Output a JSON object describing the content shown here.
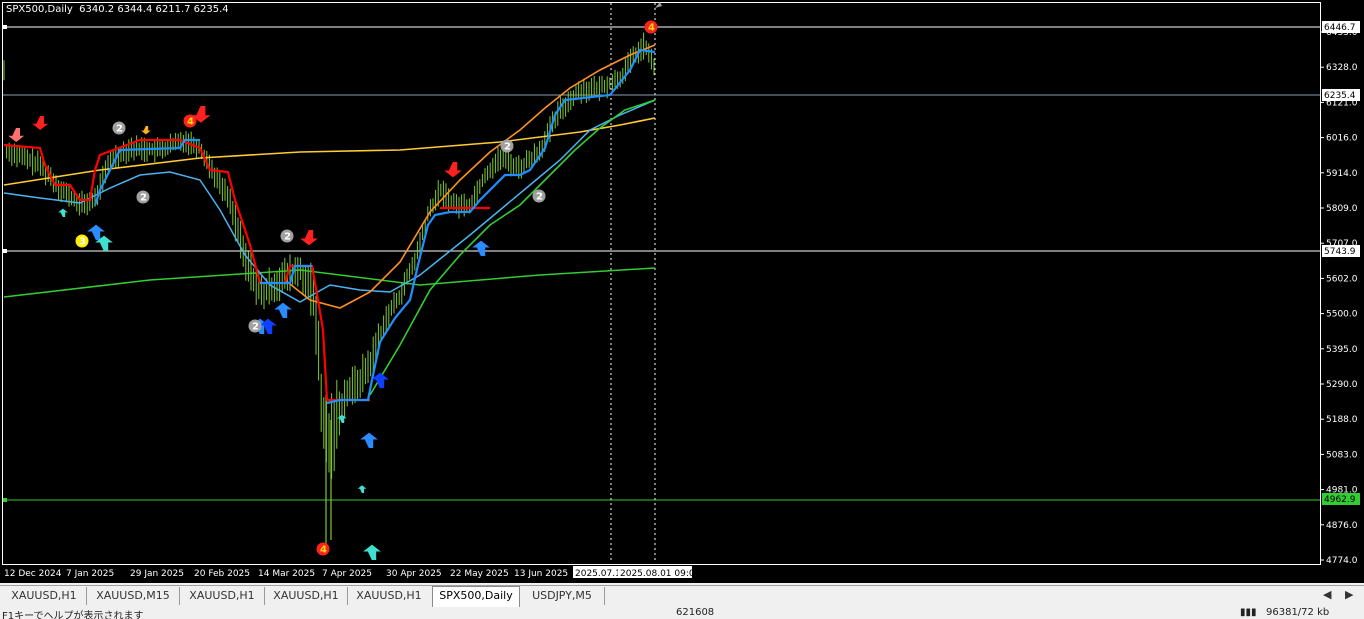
{
  "chart": {
    "symbol": "SPX500,Daily",
    "ohlc": "6340.2 6344.4 6211.7 6235.4",
    "price_labels": [
      "6433.0",
      "6328.0",
      "6121.0",
      "6016.0",
      "5914.0",
      "5809.0",
      "5707.0",
      "5602.0",
      "5500.0",
      "5395.0",
      "5290.0",
      "5188.0",
      "5083.0",
      "4981.0",
      "4876.0",
      "4774.0"
    ],
    "marker_labels": {
      "upper_level": "6446.7",
      "current_price": "6235.4",
      "middle_level": "5743.9",
      "lower_level": "4962.9"
    },
    "date_labels": [
      "12 Dec 2024",
      "7 Jan 2025",
      "29 Jan 2025",
      "20 Feb 2025",
      "14 Mar 2025",
      "7 Apr 2025",
      "30 Apr 2025",
      "22 May 2025",
      "13 Jun 2025",
      "2025.07.1",
      "2025.08.01 09:00"
    ],
    "signal_numbers": {
      "gray": "2",
      "yellow": "3",
      "red": "4"
    },
    "colors": {
      "background": "#000000",
      "candle": "#7fc832",
      "line_red": "#ff0000",
      "line_blue": "#1e90ff",
      "line_skyblue": "#4ab4f0",
      "line_green": "#32cd32",
      "line_orange": "#ff9020",
      "line_yellow": "#ffcc33",
      "arrow_down": "#ff2020",
      "arrow_up_blue": "#2a8cff",
      "arrow_up_cyan": "#40e0d0"
    }
  },
  "tabs": [
    "XAUUSD,H1",
    "XAUUSD,M15",
    "XAUUSD,H1",
    "XAUUSD,H1",
    "XAUUSD,H1",
    "SPX500,Daily",
    "USDJPY,M5"
  ],
  "active_tab": "SPX500,Daily",
  "tab_nav": {
    "left": "◀",
    "right": "▶"
  },
  "status": {
    "help": "F1キーでヘルプが表示されます",
    "code": "621608",
    "traffic": "96381/72 kb"
  }
}
